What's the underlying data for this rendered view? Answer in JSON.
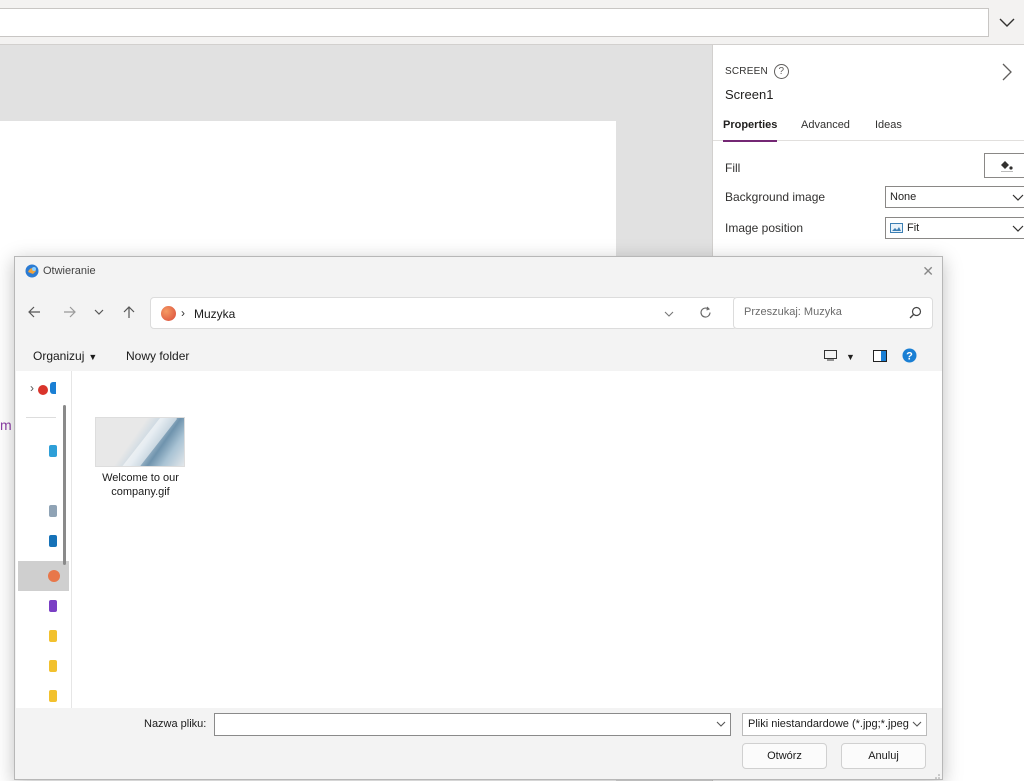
{
  "formula_bar": {
    "value": ""
  },
  "canvas": {
    "partial_text": "m"
  },
  "properties_panel": {
    "kind_label": "SCREEN",
    "help_glyph": "?",
    "control_name": "Screen1",
    "tabs": [
      {
        "label": "Properties",
        "active": true
      },
      {
        "label": "Advanced",
        "active": false
      },
      {
        "label": "Ideas",
        "active": false
      }
    ],
    "rows": {
      "fill_label": "Fill",
      "background_image_label": "Background image",
      "background_image_value": "None",
      "image_position_label": "Image position",
      "image_position_value": "Fit"
    },
    "accent_color": "#742774"
  },
  "file_dialog": {
    "title": "Otwieranie",
    "close_glyph": "✕",
    "address": {
      "separator": "›",
      "location": "Muzyka"
    },
    "search_placeholder": "Przeszukaj: Muzyka",
    "toolbar": {
      "organize_label": "Organizuj",
      "new_folder_label": "Nowy folder"
    },
    "files": [
      {
        "name": "Welcome to our company.gif",
        "type": "image"
      }
    ],
    "footer": {
      "file_name_label": "Nazwa pliku:",
      "file_name_value": "",
      "file_type_value": "Pliki niestandardowe (*.jpg;*.jpeg",
      "open_label": "Otwórz",
      "cancel_label": "Anuluj"
    },
    "icons": {
      "help": "help-icon",
      "music_folder": "music-folder-icon",
      "refresh": "refresh-icon",
      "search": "search-icon"
    },
    "help_color": "#1a7fd4"
  }
}
